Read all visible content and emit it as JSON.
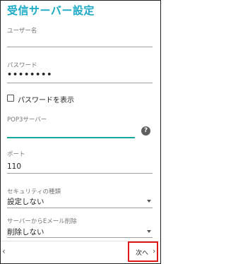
{
  "header": {
    "title": "受信サーバー設定"
  },
  "fields": {
    "username": {
      "label": "ユーザー名",
      "value": ""
    },
    "password": {
      "label": "パスワード",
      "value": "••••••••"
    },
    "show_password": {
      "label": "パスワードを表示",
      "checked": false
    },
    "pop3_server": {
      "label": "POP3サーバー",
      "value": ""
    },
    "port": {
      "label": "ポート",
      "value": "110"
    },
    "security": {
      "label": "セキュリティの種類",
      "value": "設定しない"
    },
    "delete_from_server": {
      "label": "サーバーからEメール削除",
      "value": "削除しない"
    }
  },
  "footer": {
    "prev_arrow": "‹",
    "next_label": "次へ",
    "next_arrow": "›"
  },
  "icons": {
    "help": "?"
  },
  "colors": {
    "accent_title": "#1ba9c6",
    "focus_underline": "#16a89d",
    "highlight_box": "#e01818"
  }
}
